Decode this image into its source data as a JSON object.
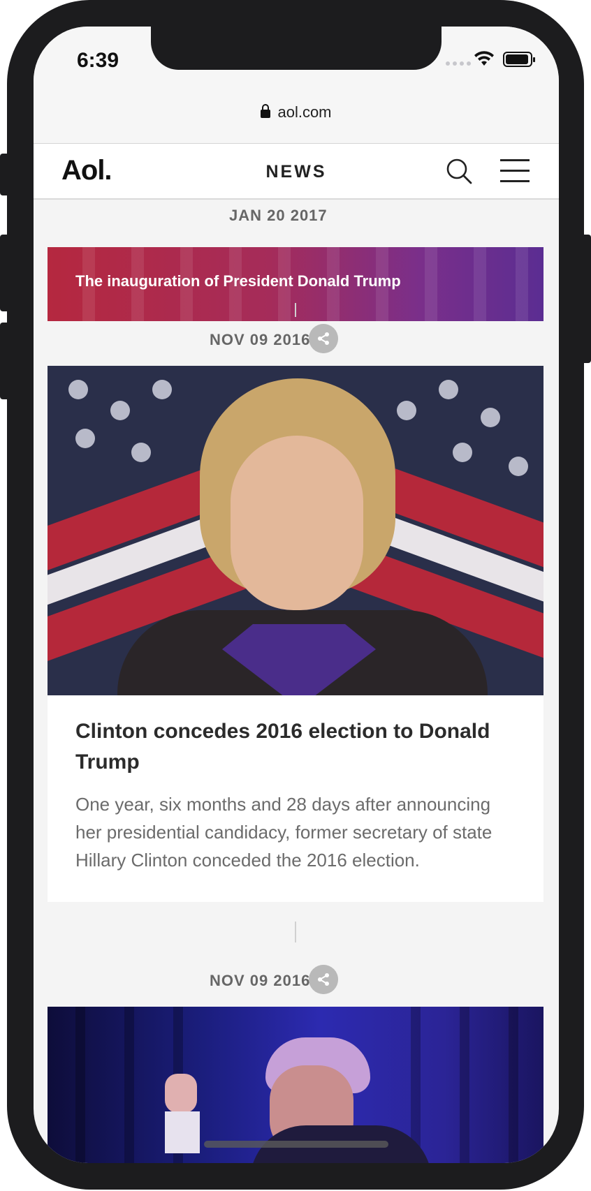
{
  "status_bar": {
    "time": "6:39"
  },
  "browser": {
    "url": "aol.com"
  },
  "site_header": {
    "logo": "Aol.",
    "section": "NEWS"
  },
  "feed": {
    "top_date": "JAN 20 2017",
    "banner_title": "The inauguration of President Donald Trump",
    "items": [
      {
        "date": "NOV 09 2016",
        "title": "Clinton concedes 2016 election to Donald Trump",
        "description": "One year, six months and 28 days after announcing her presidential candidacy, former secretary of state Hillary Clinton conceded the 2016 election."
      },
      {
        "date": "NOV 09 2016"
      }
    ]
  },
  "colors": {
    "banner_start": "#b5283f",
    "banner_end": "#5b2d92",
    "background": "#f4f4f4",
    "share_button": "#b9b9b9"
  },
  "icons": [
    "lock-icon",
    "wifi-icon",
    "battery-icon",
    "search-icon",
    "hamburger-menu-icon",
    "share-icon"
  ]
}
